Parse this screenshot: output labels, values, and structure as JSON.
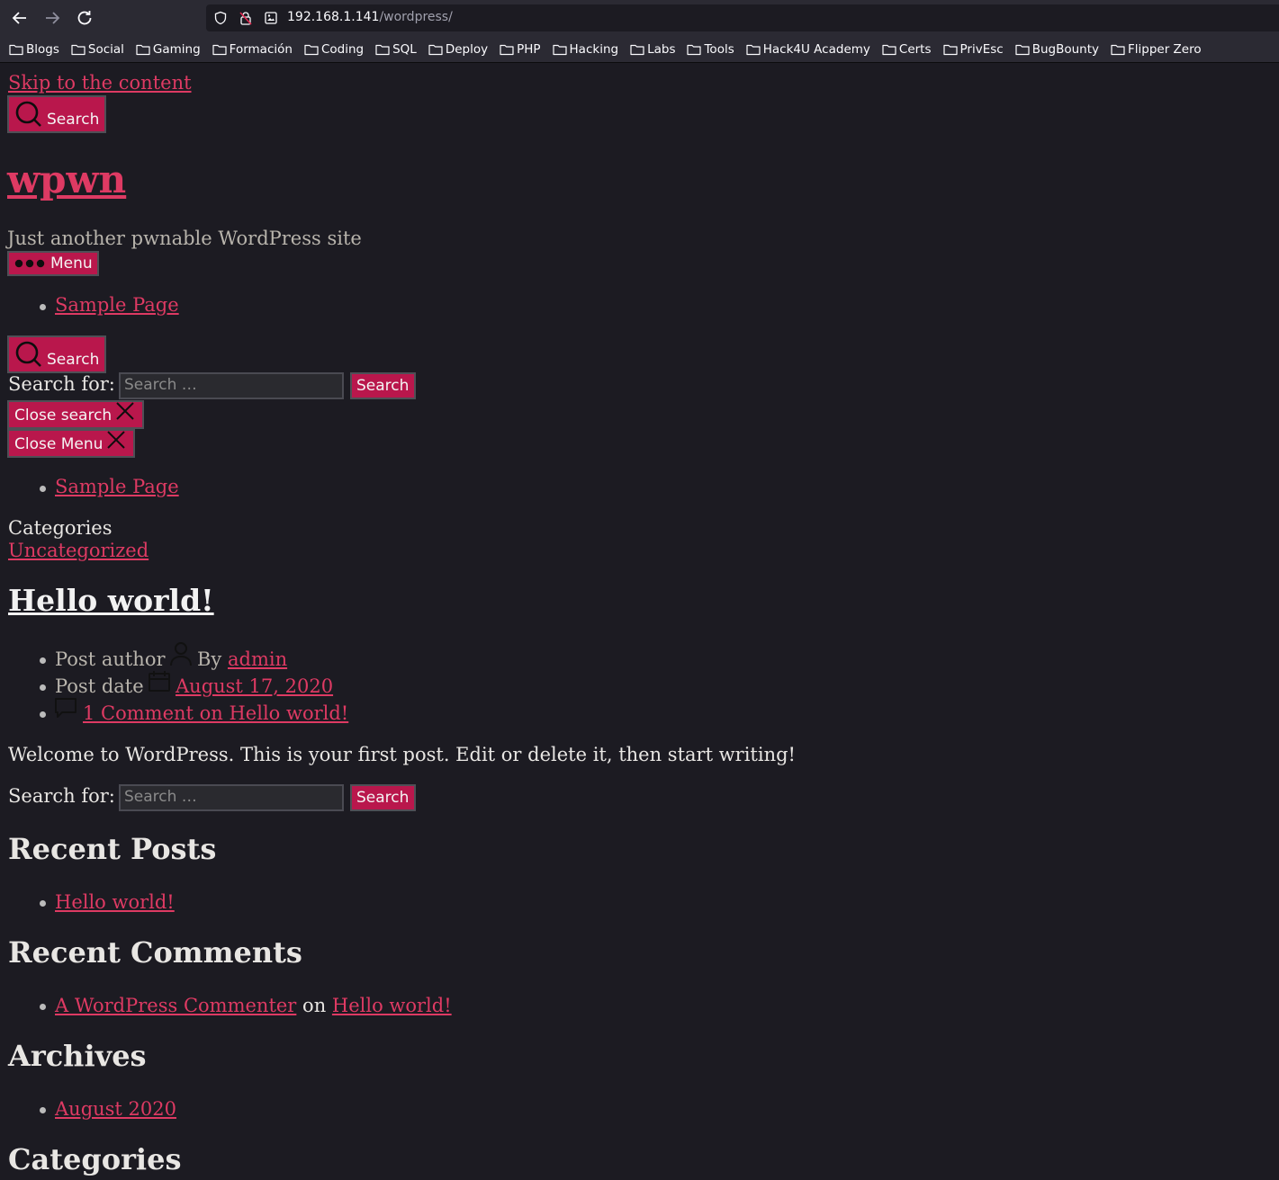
{
  "browser": {
    "url_host": "192.168.1.141",
    "url_path": "/wordpress/",
    "bookmarks": [
      "Blogs",
      "Social",
      "Gaming",
      "Formación",
      "Coding",
      "SQL",
      "Deploy",
      "PHP",
      "Hacking",
      "Labs",
      "Tools",
      "Hack4U Academy",
      "Certs",
      "PrivEsc",
      "BugBounty",
      "Flipper Zero"
    ]
  },
  "page": {
    "skip_link": "Skip to the content",
    "search_toggle_label": "Search",
    "site_title": "wpwn",
    "site_description": "Just another pwnable WordPress site",
    "menu_toggle_label": "Menu",
    "nav_items": [
      "Sample Page"
    ],
    "search_modal": {
      "toggle_label": "Search",
      "form_label": "Search for:",
      "placeholder": "Search …",
      "submit": "Search",
      "close_label": "Close search"
    },
    "menu_modal": {
      "close_label": "Close Menu",
      "items": [
        "Sample Page"
      ]
    },
    "post": {
      "categories_label": "Categories",
      "category": "Uncategorized",
      "title": "Hello world!",
      "author_label": "Post author",
      "by": "By",
      "author": "admin",
      "date_label": "Post date",
      "date": "August 17, 2020",
      "comments_link": "1 Comment on Hello world!",
      "content": "Welcome to WordPress. This is your first post. Edit or delete it, then start writing!"
    },
    "widgets": {
      "search": {
        "label": "Search for:",
        "placeholder": "Search …",
        "submit": "Search"
      },
      "recent_posts": {
        "title": "Recent Posts",
        "items": [
          "Hello world!"
        ]
      },
      "recent_comments": {
        "title": "Recent Comments",
        "commenter": "A WordPress Commenter",
        "on": "on",
        "post": "Hello world!"
      },
      "archives": {
        "title": "Archives",
        "items": [
          "August 2020"
        ]
      },
      "categories": {
        "title": "Categories"
      }
    }
  },
  "colors": {
    "background": "#1c1b22",
    "accent": "#de3a63",
    "button": "#b9174c"
  }
}
